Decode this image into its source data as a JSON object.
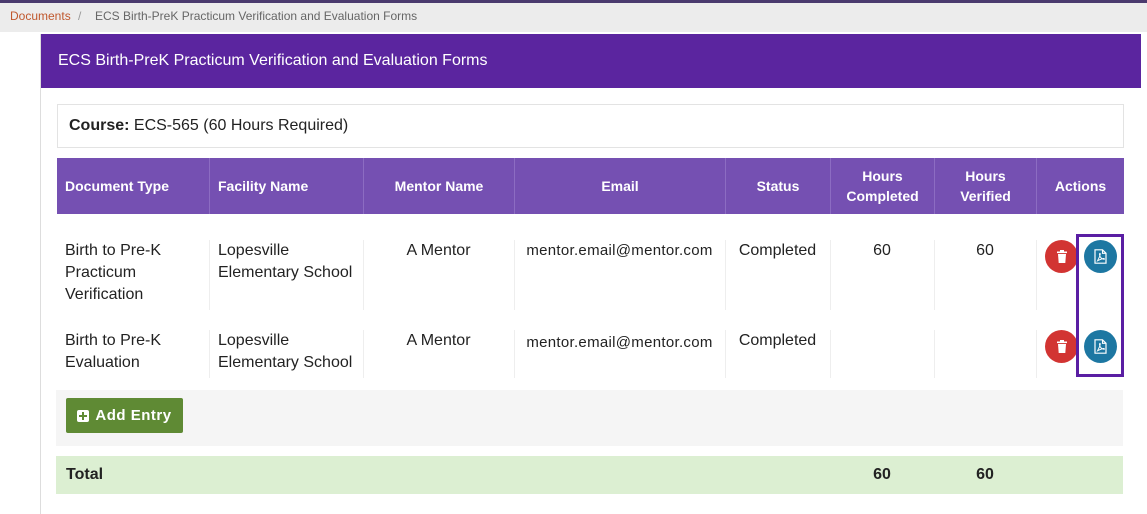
{
  "breadcrumb": {
    "root": "Documents",
    "separator": "/",
    "current": "ECS Birth-PreK Practicum Verification and Evaluation Forms"
  },
  "panel": {
    "title": "ECS Birth-PreK Practicum Verification and Evaluation Forms"
  },
  "course": {
    "label": "Course:",
    "value": "ECS-565 (60 Hours Required)"
  },
  "table": {
    "headers": {
      "document_type": "Document Type",
      "facility_name": "Facility Name",
      "mentor_name": "Mentor Name",
      "email": "Email",
      "status": "Status",
      "hours_completed_1": "Hours",
      "hours_completed_2": "Completed",
      "hours_verified_1": "Hours",
      "hours_verified_2": "Verified",
      "actions": "Actions"
    },
    "rows": [
      {
        "document_type": "Birth to Pre-K Practicum Verification",
        "facility_name": "Lopesville Elementary School",
        "mentor_name": "A Mentor",
        "email": "mentor.email@mentor.com",
        "status": "Completed",
        "hours_completed": "60",
        "hours_verified": "60"
      },
      {
        "document_type": "Birth to Pre-K Evaluation",
        "facility_name": "Lopesville Elementary School",
        "mentor_name": "A Mentor",
        "email": "mentor.email@mentor.com",
        "status": "Completed",
        "hours_completed": "",
        "hours_verified": ""
      }
    ]
  },
  "add_entry_label": "Add Entry",
  "total": {
    "label": "Total",
    "hours_completed": "60",
    "hours_verified": "60"
  },
  "colors": {
    "header_purple": "#5b259f",
    "table_head": "#7550b2",
    "delete_red": "#d23432",
    "pdf_blue": "#1d77a2",
    "add_green": "#5f8a34",
    "total_bg": "#dcefd2",
    "highlight": "#5a1ea3"
  },
  "icons": {
    "delete": "trash-icon",
    "pdf": "file-pdf-icon",
    "add": "plus-square-icon"
  }
}
